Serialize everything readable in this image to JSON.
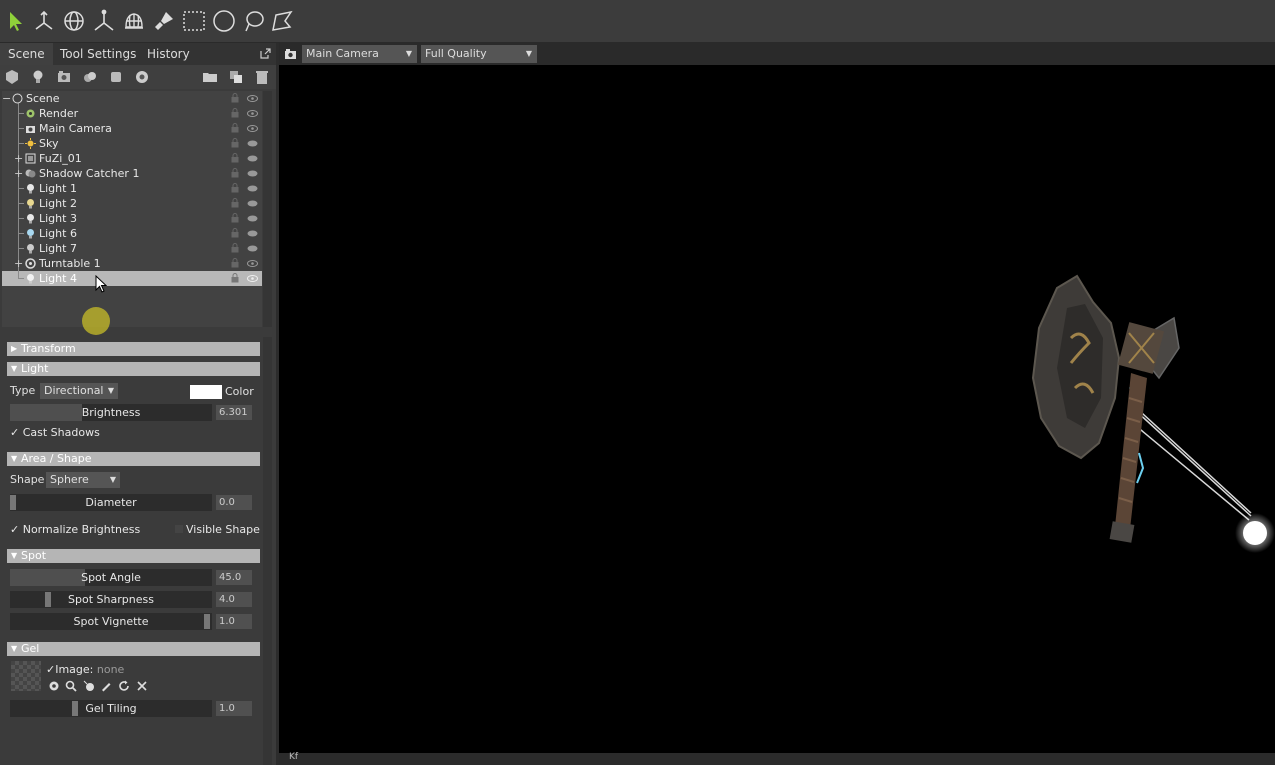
{
  "toolbar": {
    "tools": [
      {
        "icon": "select-arrow-icon"
      },
      {
        "icon": "move-gizmo-icon"
      },
      {
        "icon": "rotate-gizmo-icon"
      },
      {
        "icon": "scale-gizmo-icon"
      },
      {
        "icon": "mesh-sphere-icon"
      },
      {
        "icon": "paint-brush-icon"
      },
      {
        "icon": "rect-select-icon"
      },
      {
        "icon": "ellipse-select-icon"
      },
      {
        "icon": "lasso-select-icon"
      },
      {
        "icon": "poly-select-icon"
      }
    ]
  },
  "panel": {
    "tabs": [
      "Scene",
      "Tool Settings",
      "History"
    ],
    "active_tab": "Scene"
  },
  "outliner": {
    "items": [
      {
        "label": "Scene",
        "icon": "scene-icon"
      },
      {
        "label": "Render",
        "icon": "render-gear-icon"
      },
      {
        "label": "Main Camera",
        "icon": "camera-icon"
      },
      {
        "label": "Sky",
        "icon": "sky-icon"
      },
      {
        "label": "FuZi_01",
        "icon": "mesh-icon"
      },
      {
        "label": "Shadow Catcher 1",
        "icon": "shadow-catcher-icon"
      },
      {
        "label": "Light 1",
        "icon": "light-bulb-icon"
      },
      {
        "label": "Light 2",
        "icon": "light-bulb-icon"
      },
      {
        "label": "Light 3",
        "icon": "light-bulb-icon"
      },
      {
        "label": "Light 6",
        "icon": "light-bulb-icon"
      },
      {
        "label": "Light 7",
        "icon": "light-bulb-icon"
      },
      {
        "label": "Turntable 1",
        "icon": "turntable-icon"
      },
      {
        "label": "Light 4",
        "icon": "light-bulb-icon"
      }
    ],
    "selected": "Light 4"
  },
  "props": {
    "transform": {
      "title": "Transform"
    },
    "light": {
      "title": "Light",
      "type_label": "Type",
      "type_value": "Directional",
      "color_label": "Color",
      "color_value": "#ffffff",
      "brightness_label": "Brightness",
      "brightness_value": "6.301",
      "cast_shadows_label": "Cast Shadows",
      "cast_shadows": true
    },
    "area": {
      "title": "Area / Shape",
      "shape_label": "Shape",
      "shape_value": "Sphere",
      "diameter_label": "Diameter",
      "diameter_value": "0.0",
      "normalize_label": "Normalize Brightness",
      "normalize": true,
      "visible_shape_label": "Visible Shape",
      "visible_shape": false
    },
    "spot": {
      "title": "Spot",
      "angle_label": "Spot Angle",
      "angle_value": "45.0",
      "sharpness_label": "Spot Sharpness",
      "sharpness_value": "4.0",
      "vignette_label": "Spot Vignette",
      "vignette_value": "1.0"
    },
    "gel": {
      "title": "Gel",
      "image_label": "Image:",
      "image_value": "none",
      "tiling_label": "Gel Tiling",
      "tiling_value": "1.0"
    }
  },
  "viewport": {
    "camera_select": "Main Camera",
    "quality_select": "Full Quality",
    "bottom_tab": "Kf"
  }
}
